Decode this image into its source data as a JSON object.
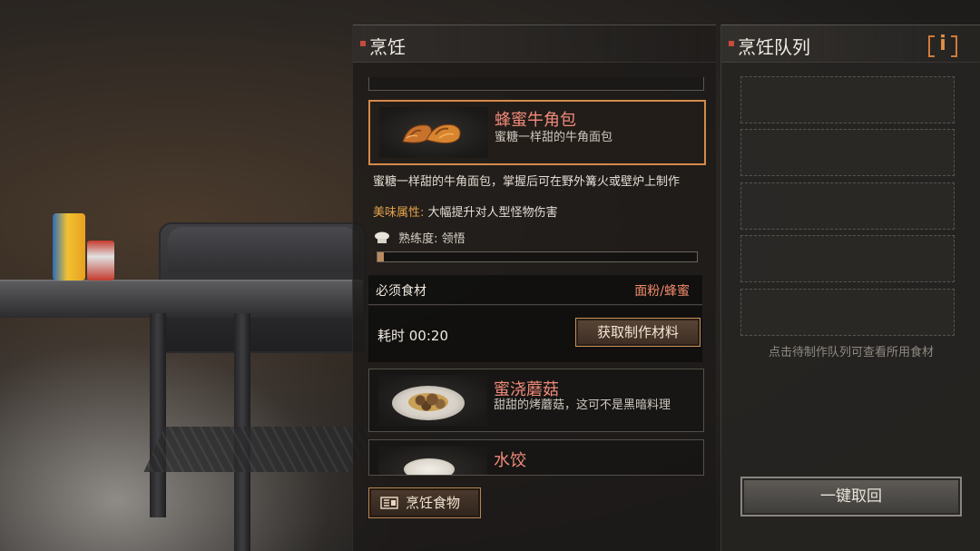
{
  "cooking_panel": {
    "title": "烹饪",
    "recipes": [
      {
        "name": "蜂蜜牛角包",
        "desc": "蜜糖一样甜的牛角面包",
        "icon": "croissant-icon",
        "selected": true
      },
      {
        "name": "蜜浇蘑菇",
        "desc": "甜甜的烤蘑菇，这可不是黑暗料理",
        "icon": "honey-mushroom-icon",
        "selected": false
      },
      {
        "name": "水饺",
        "desc": "",
        "icon": "dumpling-icon",
        "selected": false
      }
    ],
    "detail": {
      "description": "蜜糖一样甜的牛角面包，掌握后可在野外篝火或壁炉上制作",
      "attribute_label": "美味属性:",
      "attribute_value": "大幅提升对人型怪物伤害",
      "mastery": "熟练度: 领悟",
      "mastery_progress": 0.02
    },
    "ingredients": {
      "label": "必须食材",
      "value": "面粉/蜂蜜"
    },
    "time": "耗时 00:20",
    "get_materials_button": "获取制作材料",
    "cook_button": "烹饪食物"
  },
  "queue_panel": {
    "title": "烹饪队列",
    "info_button": "i",
    "slots": [
      "",
      "",
      "",
      "",
      ""
    ],
    "hint": "点击待制作队列可查看所用食材",
    "recall_button": "一键取回"
  },
  "colors": {
    "accent": "#d48a4a",
    "name": "#f08a7a",
    "attr": "#e2a24a"
  }
}
